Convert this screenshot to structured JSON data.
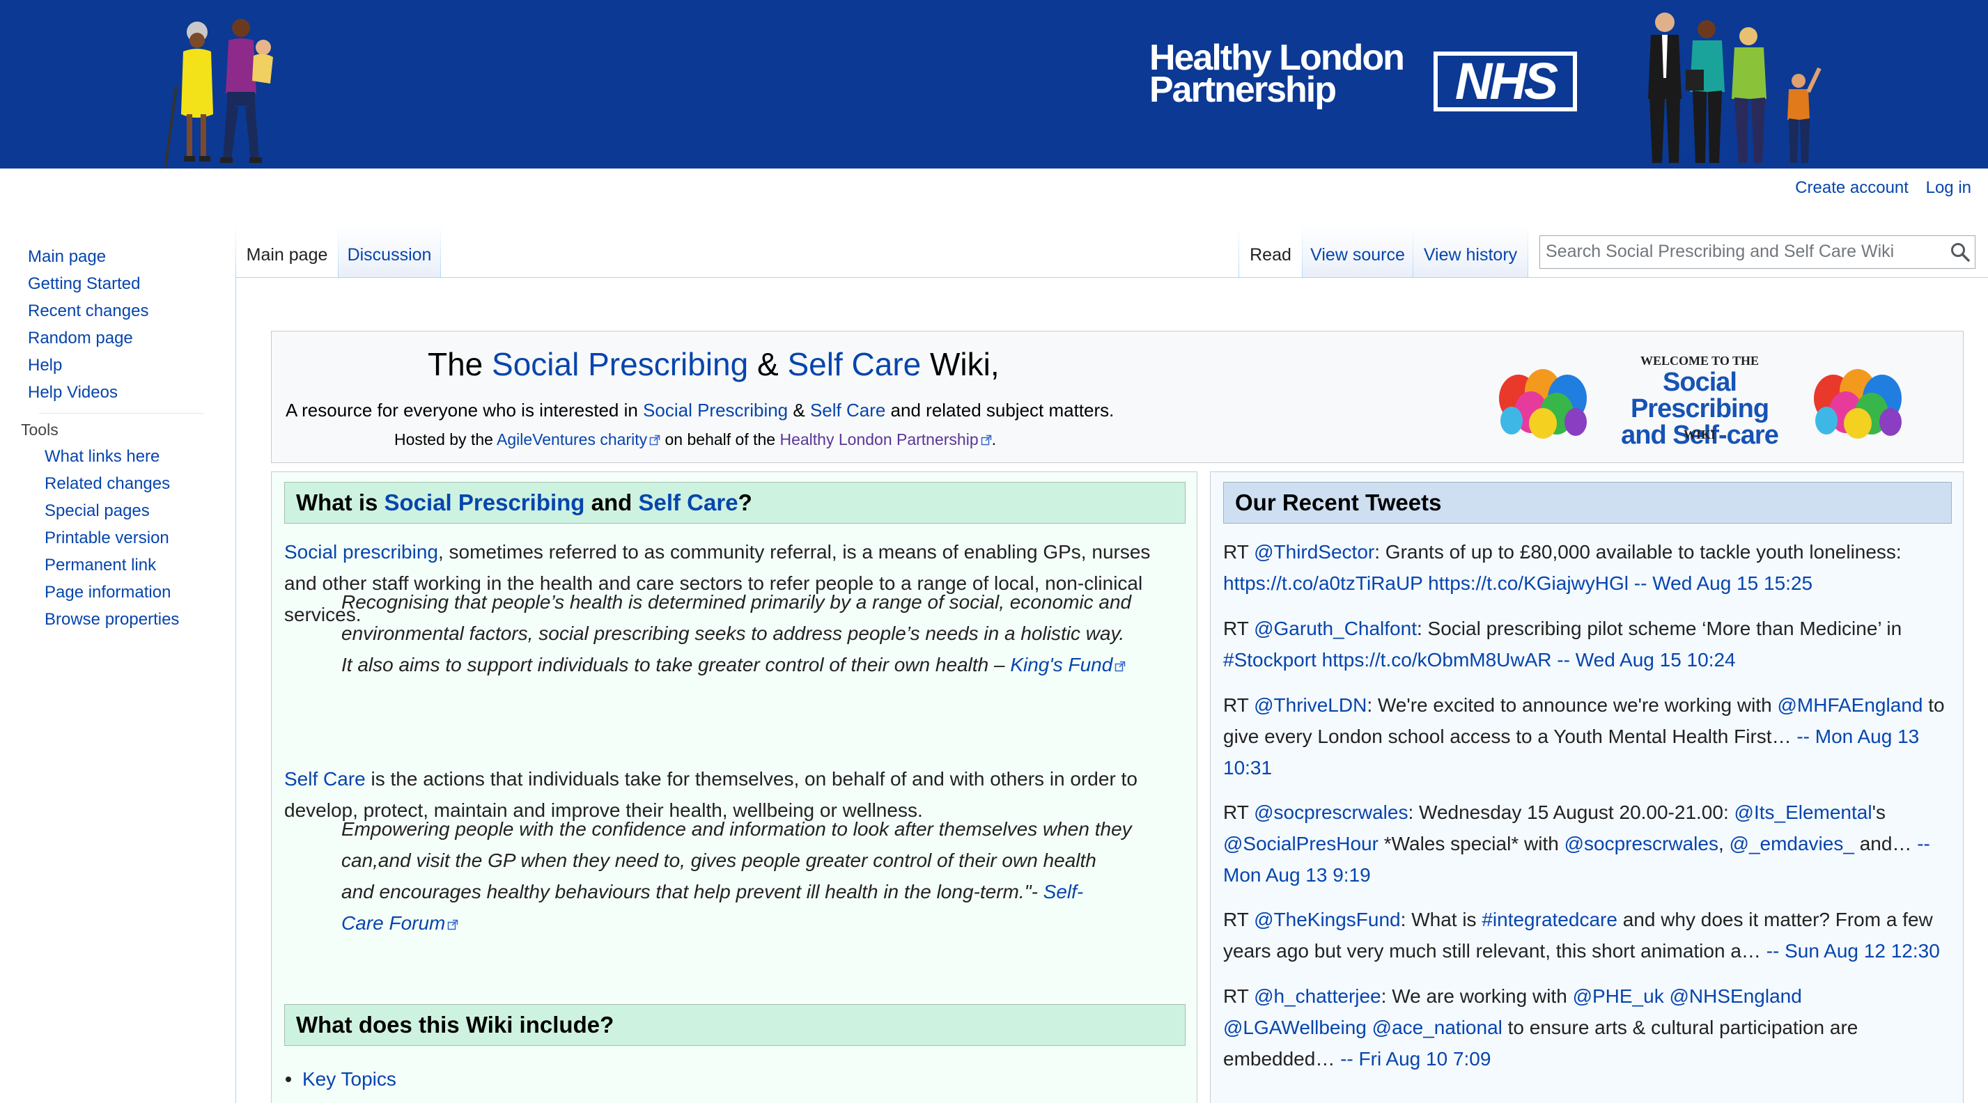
{
  "banner": {
    "org_line1": "Healthy London",
    "org_line2": "Partnership",
    "nhs": "NHS"
  },
  "personal": {
    "create_account": "Create account",
    "log_in": "Log in"
  },
  "sidebar": {
    "navigation": [
      {
        "label": "Main page"
      },
      {
        "label": "Getting Started"
      },
      {
        "label": "Recent changes"
      },
      {
        "label": "Random page"
      },
      {
        "label": "Help"
      },
      {
        "label": "Help Videos"
      }
    ],
    "tools_heading": "Tools",
    "tools": [
      {
        "label": "What links here"
      },
      {
        "label": "Related changes"
      },
      {
        "label": "Special pages"
      },
      {
        "label": "Printable version"
      },
      {
        "label": "Permanent link"
      },
      {
        "label": "Page information"
      },
      {
        "label": "Browse properties"
      }
    ]
  },
  "tabs": {
    "main_page": "Main page",
    "discussion": "Discussion",
    "read": "Read",
    "view_source": "View source",
    "view_history": "View history"
  },
  "search": {
    "placeholder": "Search Social Prescribing and Self Care Wiki"
  },
  "intro": {
    "title_pre": "The ",
    "title_link1": "Social Prescribing",
    "title_amp": " & ",
    "title_link2": "Self Care",
    "title_post": " Wiki,",
    "line1_pre": "A resource for everyone who is interested in ",
    "line1_link1": "Social Prescribing",
    "line1_amp": " & ",
    "line1_link2": "Self Care",
    "line1_post": " and related subject matters.",
    "line2_pre": "Hosted by the ",
    "line2_link1": "AgileVentures charity",
    "line2_mid": " on behalf of the ",
    "line2_link2": "Healthy London Partnership",
    "line2_post": "."
  },
  "welcome_logo": {
    "top": "WELCOME TO THE",
    "line1": "Social Prescribing",
    "line2": "and Self-care",
    "bottom": "WIKI"
  },
  "what_is": {
    "heading_pre": "What is ",
    "heading_link1": "Social Prescribing",
    "heading_and": " and ",
    "heading_link2": "Self Care",
    "heading_post": "?",
    "p1_link": "Social prescribing",
    "p1_l1": ", sometimes referred to as community referral, is a means of enabling GPs, nurses",
    "p1_l2": "and other staff working in the health and care sectors to refer people to a range of local, non-clinical",
    "p1_l3": "services.",
    "q1_l1": "Recognising that people’s health is determined primarily by a range of social, economic and",
    "q1_l2": "environmental factors, social prescribing seeks to address people’s needs in a holistic way.",
    "q1_l3": "It also aims to support individuals to take greater control of their own health – ",
    "q1_link": "King's Fund",
    "p2_link": "Self Care",
    "p2_l1": " is the actions that individuals take for themselves, on behalf of and with others in order to",
    "p2_l2": "develop, protect, maintain and improve their health, wellbeing or wellness.",
    "q2_l1": "Empowering people with the confidence and information to look after themselves when they",
    "q2_l2": "can,and visit the GP when they need to, gives people greater control of their own health",
    "q2_l3": "and encourages healthy behaviours that help prevent ill health in the long-term.\"- ",
    "q2_link1": "Self-",
    "q2_link2": "Care Forum"
  },
  "wiki_include": {
    "heading": "What does this Wiki include?",
    "item1": "Key Topics"
  },
  "tweets": {
    "heading": "Our Recent Tweets",
    "t1": {
      "rt": "RT ",
      "user": "@ThirdSector",
      "text": ": Grants of up to £80,000 available to tackle youth loneliness:",
      "link1": "https://t.co/a0tzTiRaUP",
      "link2": "https://t.co/KGiajwyHGl",
      "date": "-- Wed Aug 15 15:25"
    },
    "t2": {
      "rt": "RT ",
      "user": "@Garuth_Chalfont",
      "text": ": Social prescribing pilot scheme ‘More than Medicine’ in",
      "hashtag": "#Stockport",
      "link": "https://t.co/kObmM8UwAR",
      "date": "-- Wed Aug 15 10:24"
    },
    "t3": {
      "rt": "RT ",
      "user": "@ThriveLDN",
      "text1": ": We're excited to announce we're working with ",
      "mention": "@MHFAEngland",
      "text2": " to",
      "text3": "give every London school access to a Youth Mental Health First… ",
      "date1": "-- Mon Aug 13",
      "date2": "10:31"
    },
    "t4": {
      "rt": "RT ",
      "user": "@socprescrwales",
      "text1": ": Wednesday 15 August 20.00-21.00: ",
      "mention1": "@Its_Elemental",
      "text2": "'s",
      "mention2": "@SocialPresHour",
      "text3": " *Wales special* with ",
      "mention3": "@socprescrwales",
      "text4": ", ",
      "mention4": "@_emdavies_",
      "text5": " and… ",
      "date1": "--",
      "date2": "Mon Aug 13 9:19"
    },
    "t5": {
      "rt": "RT ",
      "user": "@TheKingsFund",
      "text1": ": What is ",
      "hashtag": "#integratedcare",
      "text2": " and why does it matter? From a few",
      "text3": "years ago but very much still relevant, this short animation a… ",
      "date": "-- Sun Aug 12 12:30"
    },
    "t6": {
      "rt": "RT ",
      "user": "@h_chatterjee",
      "text1": ": We are working with ",
      "mention1": "@PHE_uk",
      "mention2": "@NHSEngland",
      "mention3": "@LGAWellbeing",
      "mention4": "@ace_national",
      "text2": " to ensure arts & cultural participation are",
      "text3": "embedded… ",
      "date": "-- Fri Aug 10 7:09"
    }
  },
  "colors": {
    "banner": "#0b3994",
    "link": "#0645ad",
    "visited_link": "#5a3696",
    "green_header": "#cef2e0",
    "blue_header": "#cedff2"
  }
}
